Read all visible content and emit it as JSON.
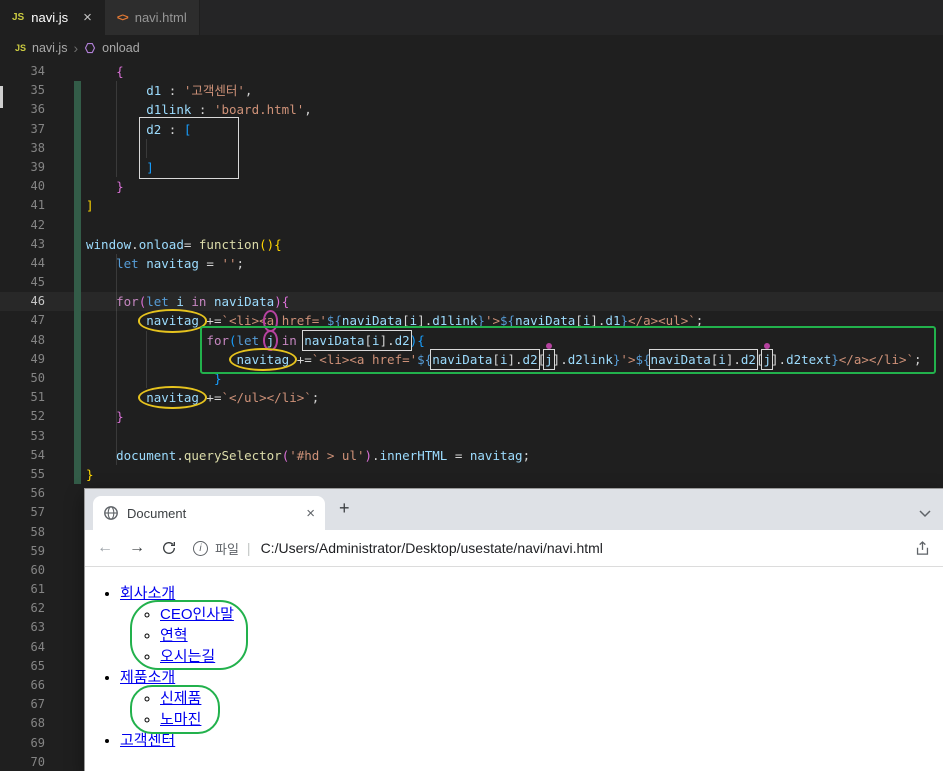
{
  "editor_tabs": [
    {
      "icon": "JS",
      "label": "navi.js",
      "close": "×"
    },
    {
      "icon": "<>",
      "label": "navi.html"
    }
  ],
  "breadcrumb": {
    "icon": "JS",
    "file": "navi.js",
    "sep": "›",
    "symbol": "onload"
  },
  "editor": {
    "active_line": "46",
    "lines": [
      {
        "num": "34",
        "tokens": [
          {
            "t": "    ",
            "c": "w"
          },
          {
            "t": "{",
            "c": "pk"
          }
        ]
      },
      {
        "num": "35",
        "tokens": [
          {
            "t": "        ",
            "c": "w"
          },
          {
            "t": "d1",
            "c": "lb"
          },
          {
            "t": " : ",
            "c": "w"
          },
          {
            "t": "'고객센터'",
            "c": "s"
          },
          {
            "t": ",",
            "c": "w"
          }
        ]
      },
      {
        "num": "36",
        "tokens": [
          {
            "t": "        ",
            "c": "w"
          },
          {
            "t": "d1link",
            "c": "lb"
          },
          {
            "t": " : ",
            "c": "w"
          },
          {
            "t": "'board.html'",
            "c": "s"
          },
          {
            "t": ",",
            "c": "w"
          }
        ]
      },
      {
        "num": "37",
        "tokens": [
          {
            "t": "        ",
            "c": "w"
          },
          {
            "t": "d2",
            "c": "lb"
          },
          {
            "t": " : ",
            "c": "w"
          },
          {
            "t": "[",
            "c": "b2"
          }
        ]
      },
      {
        "num": "38",
        "tokens": []
      },
      {
        "num": "39",
        "tokens": [
          {
            "t": "        ",
            "c": "w"
          },
          {
            "t": "]",
            "c": "b2"
          }
        ]
      },
      {
        "num": "40",
        "tokens": [
          {
            "t": "    ",
            "c": "w"
          },
          {
            "t": "}",
            "c": "pk"
          }
        ]
      },
      {
        "num": "41",
        "tokens": [
          {
            "t": "]",
            "c": "gd"
          }
        ]
      },
      {
        "num": "42",
        "tokens": []
      },
      {
        "num": "43",
        "tokens": [
          {
            "t": "window",
            "c": "lb"
          },
          {
            "t": ".",
            "c": "w"
          },
          {
            "t": "onload",
            "c": "lb"
          },
          {
            "t": "= ",
            "c": "w"
          },
          {
            "t": "function",
            "c": "y"
          },
          {
            "t": "(){",
            "c": "gd"
          }
        ]
      },
      {
        "num": "44",
        "tokens": [
          {
            "t": "    ",
            "c": "w"
          },
          {
            "t": "let",
            "c": "b"
          },
          {
            "t": " ",
            "c": "w"
          },
          {
            "t": "navitag",
            "c": "lb"
          },
          {
            "t": " = ",
            "c": "w"
          },
          {
            "t": "''",
            "c": "s"
          },
          {
            "t": ";",
            "c": "w"
          }
        ]
      },
      {
        "num": "45",
        "tokens": []
      },
      {
        "num": "46",
        "tokens": [
          {
            "t": "    ",
            "c": "w"
          },
          {
            "t": "for",
            "c": "p"
          },
          {
            "t": "(",
            "c": "pk"
          },
          {
            "t": "let",
            "c": "b"
          },
          {
            "t": " ",
            "c": "w"
          },
          {
            "t": "i",
            "c": "lb"
          },
          {
            "t": " ",
            "c": "w"
          },
          {
            "t": "in",
            "c": "p"
          },
          {
            "t": " ",
            "c": "w"
          },
          {
            "t": "naviData",
            "c": "lb"
          },
          {
            "t": "){",
            "c": "pk"
          }
        ]
      },
      {
        "num": "47",
        "tokens": [
          {
            "t": "        ",
            "c": "w"
          },
          {
            "t": "navitag",
            "c": "lb",
            "m": "ye"
          },
          {
            "t": " +=",
            "c": "w"
          },
          {
            "t": "`<li><",
            "c": "s"
          },
          {
            "t": "a",
            "c": "s",
            "m": "pc"
          },
          {
            "t": " href='",
            "c": "s"
          },
          {
            "t": "${",
            "c": "b"
          },
          {
            "t": "naviData",
            "c": "lb"
          },
          {
            "t": "[",
            "c": "w"
          },
          {
            "t": "i",
            "c": "lb"
          },
          {
            "t": "].",
            "c": "w"
          },
          {
            "t": "d1link",
            "c": "lb"
          },
          {
            "t": "}",
            "c": "b"
          },
          {
            "t": "'>",
            "c": "s"
          },
          {
            "t": "${",
            "c": "b"
          },
          {
            "t": "naviData",
            "c": "lb"
          },
          {
            "t": "[",
            "c": "w"
          },
          {
            "t": "i",
            "c": "lb"
          },
          {
            "t": "].",
            "c": "w"
          },
          {
            "t": "d1",
            "c": "lb"
          },
          {
            "t": "}",
            "c": "b"
          },
          {
            "t": "</a><ul>`",
            "c": "s"
          },
          {
            "t": ";",
            "c": "w"
          }
        ]
      },
      {
        "num": "48",
        "tokens": [
          {
            "t": "                ",
            "c": "w"
          },
          {
            "t": "for",
            "c": "p"
          },
          {
            "t": "(",
            "c": "b2"
          },
          {
            "t": "let",
            "c": "b"
          },
          {
            "t": " ",
            "c": "w"
          },
          {
            "t": "j",
            "c": "lb",
            "m": "pc"
          },
          {
            "t": " ",
            "c": "w"
          },
          {
            "t": "in",
            "c": "p"
          },
          {
            "t": " ",
            "c": "w"
          },
          {
            "t": "naviData",
            "c": "lb",
            "g": "a"
          },
          {
            "t": "[",
            "c": "w",
            "g": "a"
          },
          {
            "t": "i",
            "c": "lb",
            "g": "a"
          },
          {
            "t": "].",
            "c": "w",
            "g": "a"
          },
          {
            "t": "d2",
            "c": "lb",
            "g": "a"
          },
          {
            "t": "){",
            "c": "b2"
          }
        ]
      },
      {
        "num": "49",
        "tokens": [
          {
            "t": "                    ",
            "c": "w"
          },
          {
            "t": "navitag",
            "c": "lb",
            "m": "ye"
          },
          {
            "t": " +=",
            "c": "w"
          },
          {
            "t": "`<li><a href='",
            "c": "s"
          },
          {
            "t": "${",
            "c": "b"
          },
          {
            "t": "naviData",
            "c": "lb",
            "g": "b"
          },
          {
            "t": "[",
            "c": "w",
            "g": "b"
          },
          {
            "t": "i",
            "c": "lb",
            "g": "b"
          },
          {
            "t": "].",
            "c": "w",
            "g": "b"
          },
          {
            "t": "d2",
            "c": "lb",
            "g": "b"
          },
          {
            "t": "[",
            "c": "w"
          },
          {
            "t": "j",
            "c": "lb",
            "m": "wbd"
          },
          {
            "t": "].",
            "c": "w"
          },
          {
            "t": "d2link",
            "c": "lb"
          },
          {
            "t": "}",
            "c": "b"
          },
          {
            "t": "'>",
            "c": "s"
          },
          {
            "t": "${",
            "c": "b"
          },
          {
            "t": "naviData",
            "c": "lb",
            "g": "c"
          },
          {
            "t": "[",
            "c": "w",
            "g": "c"
          },
          {
            "t": "i",
            "c": "lb",
            "g": "c"
          },
          {
            "t": "].",
            "c": "w",
            "g": "c"
          },
          {
            "t": "d2",
            "c": "lb",
            "g": "c"
          },
          {
            "t": "[",
            "c": "w"
          },
          {
            "t": "j",
            "c": "lb",
            "m": "wbd"
          },
          {
            "t": "].",
            "c": "w"
          },
          {
            "t": "d2text",
            "c": "lb"
          },
          {
            "t": "}",
            "c": "b"
          },
          {
            "t": "</a></li>`",
            "c": "s"
          },
          {
            "t": ";",
            "c": "w"
          }
        ]
      },
      {
        "num": "50",
        "tokens": [
          {
            "t": "                 ",
            "c": "w"
          },
          {
            "t": "}",
            "c": "b2"
          }
        ]
      },
      {
        "num": "51",
        "tokens": [
          {
            "t": "        ",
            "c": "w"
          },
          {
            "t": "navitag",
            "c": "lb",
            "m": "ye"
          },
          {
            "t": " +=",
            "c": "w"
          },
          {
            "t": "`</ul></li>`",
            "c": "s"
          },
          {
            "t": ";",
            "c": "w"
          }
        ]
      },
      {
        "num": "52",
        "tokens": [
          {
            "t": "    ",
            "c": "w"
          },
          {
            "t": "}",
            "c": "pk"
          }
        ]
      },
      {
        "num": "53",
        "tokens": []
      },
      {
        "num": "54",
        "tokens": [
          {
            "t": "    ",
            "c": "w"
          },
          {
            "t": "document",
            "c": "lb"
          },
          {
            "t": ".",
            "c": "w"
          },
          {
            "t": "querySelector",
            "c": "y"
          },
          {
            "t": "(",
            "c": "pk"
          },
          {
            "t": "'#hd > ul'",
            "c": "s"
          },
          {
            "t": ")",
            "c": "pk"
          },
          {
            "t": ".",
            "c": "w"
          },
          {
            "t": "innerHTML",
            "c": "lb"
          },
          {
            "t": " = ",
            "c": "w"
          },
          {
            "t": "navitag",
            "c": "lb"
          },
          {
            "t": ";",
            "c": "w"
          }
        ]
      },
      {
        "num": "55",
        "tokens": [
          {
            "t": "}",
            "c": "gd"
          }
        ]
      },
      {
        "num": "56",
        "tokens": []
      },
      {
        "num": "57",
        "tokens": []
      },
      {
        "num": "58",
        "tokens": []
      },
      {
        "num": "59",
        "tokens": []
      },
      {
        "num": "60",
        "tokens": []
      },
      {
        "num": "61",
        "tokens": []
      },
      {
        "num": "62",
        "tokens": []
      },
      {
        "num": "63",
        "tokens": []
      },
      {
        "num": "64",
        "tokens": []
      },
      {
        "num": "65",
        "tokens": []
      },
      {
        "num": "66",
        "tokens": []
      },
      {
        "num": "67",
        "tokens": []
      },
      {
        "num": "68",
        "tokens": []
      },
      {
        "num": "69",
        "tokens": []
      },
      {
        "num": "70",
        "tokens": []
      }
    ]
  },
  "browser": {
    "tab_title": "Document",
    "tab_close": "×",
    "new_tab": "+",
    "nav_back": "←",
    "nav_forward": "→",
    "info_glyph": "i",
    "file_label": "파일",
    "divider": "|",
    "url": "C:/Users/Administrator/Desktop/usestate/navi/navi.html",
    "menu": [
      {
        "text": "회사소개",
        "children": [
          "CEO인사말",
          "연혁",
          "오시는길"
        ]
      },
      {
        "text": "제품소개",
        "children": [
          "신제품",
          "노마진"
        ]
      },
      {
        "text": "고객센터",
        "children": []
      }
    ]
  },
  "colors": {
    "annotation_yellow": "#e6c31e",
    "annotation_green": "#22b14c",
    "annotation_purple": "#b5429f",
    "annotation_box": "#d9d9d9",
    "link_blue": "#0000ee",
    "git_added": "#335c48"
  }
}
